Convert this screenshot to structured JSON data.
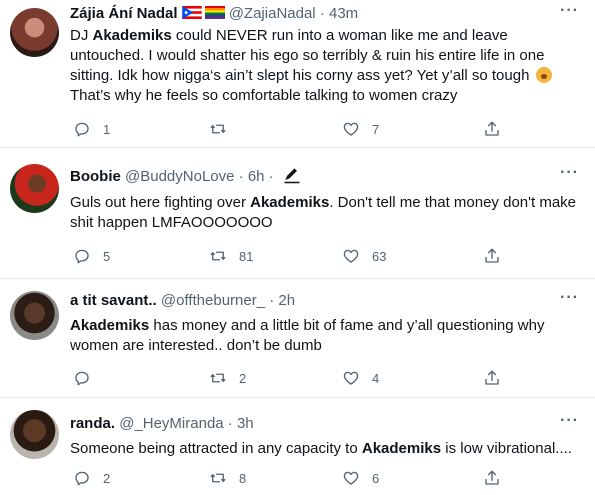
{
  "tweets": [
    {
      "name": "Zájia Ání Nadal",
      "handle": "@ZajiaNadal",
      "time": "· 43m",
      "text_parts": [
        {
          "t": "DJ ",
          "b": false
        },
        {
          "t": "Akademiks",
          "b": true
        },
        {
          "t": " could NEVER run into a woman like me and leave untouched. I would shatter his ego so terribly & ruin his entire life in one sitting. Idk how nigga‘s ain’t slept his corny ass yet? Yet y’all so tough ",
          "b": false
        },
        {
          "t": " That’s why he feels so comfortable talking to women crazy",
          "b": false
        }
      ],
      "replies": "1",
      "retweets": "",
      "likes": "7",
      "icons": [
        "puerto-rico-flag-icon",
        "pride-flag-icon",
        "yawning-face-emoji"
      ]
    },
    {
      "name": "Boobie",
      "handle": "@BuddyNoLove",
      "time": "· 6h ·",
      "text_parts": [
        {
          "t": "Guls out here fighting over ",
          "b": false
        },
        {
          "t": "Akademiks",
          "b": true
        },
        {
          "t": ".  Don't tell me that money don't make shit happen LMFAOOOOOOO",
          "b": false
        }
      ],
      "replies": "5",
      "retweets": "81",
      "likes": "63"
    },
    {
      "name": "a tit savant..",
      "handle": "@offtheburner_",
      "time": "· 2h",
      "text_parts": [
        {
          "t": "Akademiks",
          "b": true
        },
        {
          "t": " has money and a little bit of fame and y’all questioning why women are interested.. don’t be dumb",
          "b": false
        }
      ],
      "replies": "",
      "retweets": "2",
      "likes": "4"
    },
    {
      "name": "randa.",
      "handle": "@_HeyMiranda",
      "time": "· 3h",
      "text_parts": [
        {
          "t": "Someone being attracted in any capacity to ",
          "b": false
        },
        {
          "t": "Akademiks",
          "b": true
        },
        {
          "t": " is low vibrational....",
          "b": false
        }
      ],
      "replies": "2",
      "retweets": "8",
      "likes": "6"
    }
  ],
  "colors": {
    "text": "#0f1419",
    "muted": "#536471",
    "divider": "#e7e9ea"
  },
  "more_label": "···"
}
